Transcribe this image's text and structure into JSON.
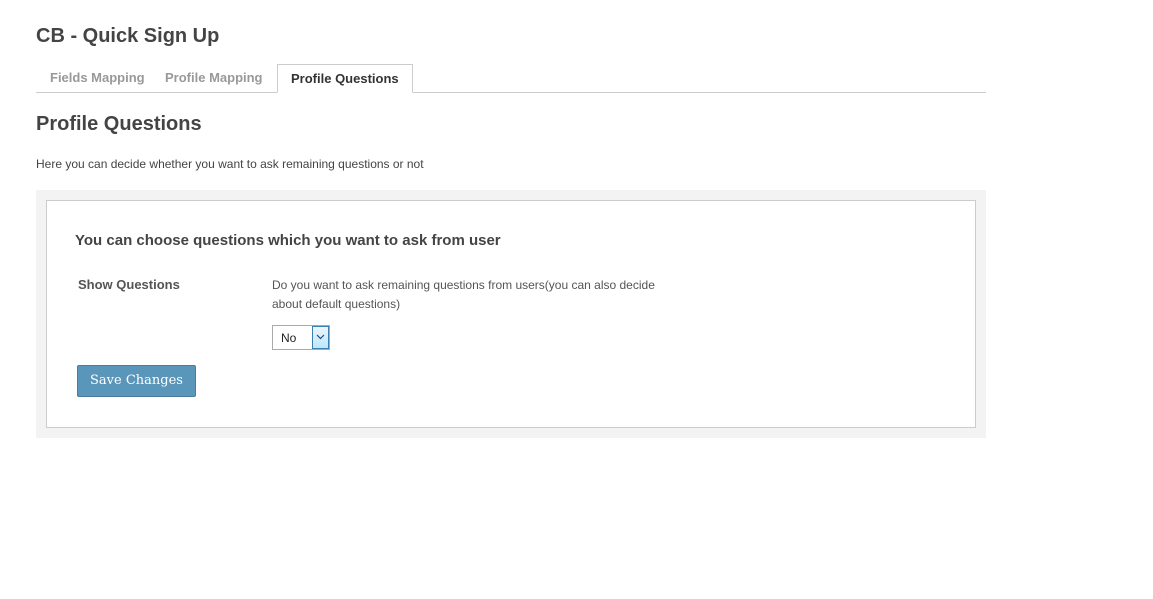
{
  "header": {
    "title": "CB - Quick Sign Up"
  },
  "tabs": [
    {
      "label": "Fields Mapping",
      "active": false
    },
    {
      "label": "Profile Mapping",
      "active": false
    },
    {
      "label": "Profile Questions",
      "active": true
    }
  ],
  "section": {
    "title": "Profile Questions",
    "description": "Here you can decide whether you want to ask remaining questions or not"
  },
  "box": {
    "heading": "You can choose questions which you want to ask from user",
    "field": {
      "label": "Show Questions",
      "help": "Do you want to ask remaining questions from users(you can also decide about default questions)",
      "select_value": "No"
    },
    "save_label": "Save Changes"
  },
  "colors": {
    "button": "#5a95ba",
    "box_background": "#f3f3f3"
  },
  "icons": {
    "select_arrow": "chevron-down-icon"
  }
}
